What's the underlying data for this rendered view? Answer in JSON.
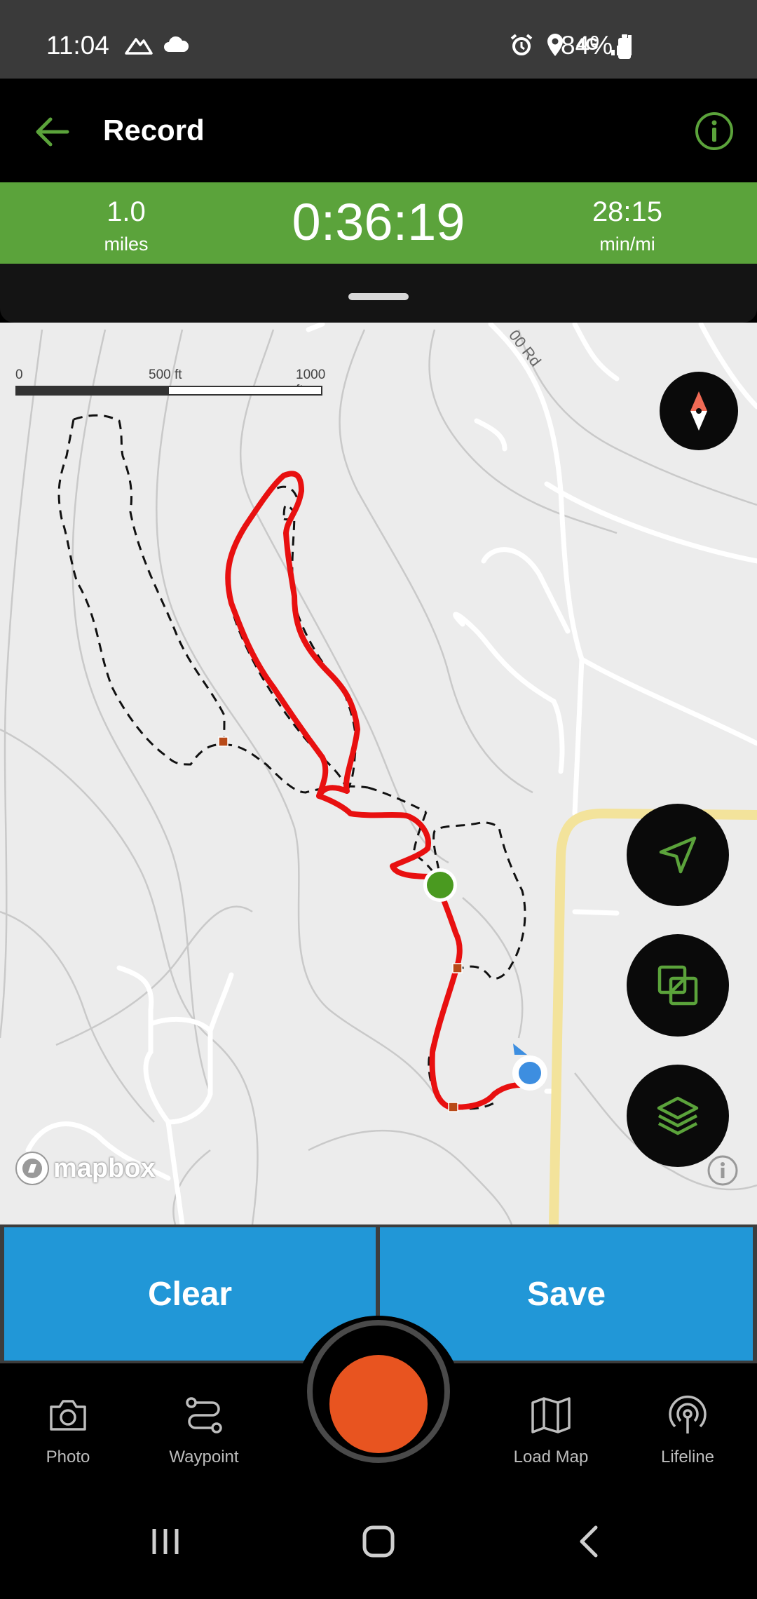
{
  "status_bar": {
    "time": "11:04",
    "battery": "84%",
    "network": "4G"
  },
  "header": {
    "title": "Record"
  },
  "stats": {
    "distance_value": "1.0",
    "distance_unit": "miles",
    "elapsed_time": "0:36:19",
    "pace_value": "28:15",
    "pace_unit": "min/mi"
  },
  "map": {
    "road_label": "00 Rd",
    "scale": {
      "start": "0",
      "mid": "500 ft",
      "end": "1000 ft"
    },
    "attribution": "mapbox"
  },
  "actions": {
    "clear_label": "Clear",
    "save_label": "Save"
  },
  "bottom_nav": {
    "items": [
      {
        "label": "Photo",
        "icon": "camera-icon"
      },
      {
        "label": "Waypoint",
        "icon": "waypoint-icon"
      },
      {
        "label": "Load Map",
        "icon": "map-icon"
      },
      {
        "label": "Lifeline",
        "icon": "lifeline-icon"
      }
    ]
  },
  "colors": {
    "accent_green": "#5ba33b",
    "action_blue": "#2197d7",
    "record_orange": "#e85420",
    "track_red": "#e81010"
  }
}
